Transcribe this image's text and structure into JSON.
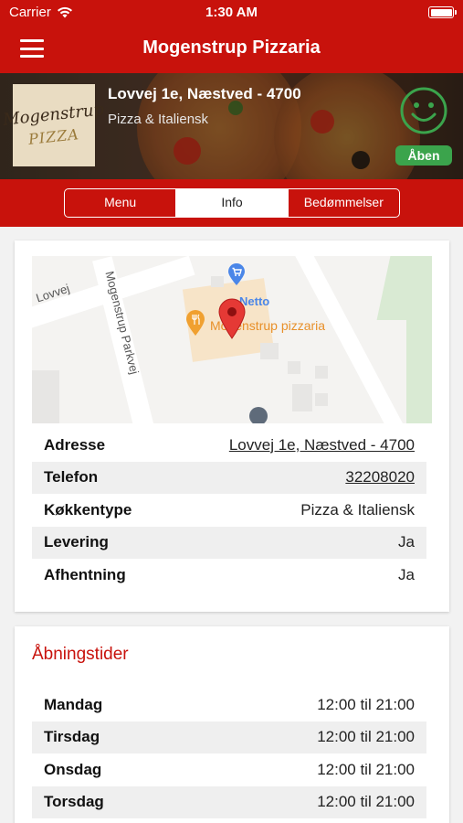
{
  "status_bar": {
    "carrier": "Carrier",
    "time": "1:30 AM"
  },
  "nav": {
    "title": "Mogenstrup Pizzaria"
  },
  "header": {
    "logo_top": "Mogenstrup",
    "logo_bottom": "PIZZA",
    "address": "Lovvej 1e, Næstved - 4700",
    "cuisine": "Pizza & Italiensk",
    "status_badge": "Åben",
    "accent_green": "#3ba44c"
  },
  "tabs": [
    {
      "label": "Menu"
    },
    {
      "label": "Info"
    },
    {
      "label": "Bedømmelser"
    }
  ],
  "map": {
    "street_1": "Lovvej",
    "street_2": "Mogenstrup Parkvej",
    "poi_label": "Mogenstrup pizzaria",
    "poi_label_2": "Netto"
  },
  "info": {
    "rows": [
      {
        "key": "Adresse",
        "value": "Lovvej 1e, Næstved - 4700"
      },
      {
        "key": "Telefon",
        "value": "32208020"
      },
      {
        "key": "Køkkentype",
        "value": "Pizza & Italiensk"
      },
      {
        "key": "Levering",
        "value": "Ja"
      },
      {
        "key": "Afhentning",
        "value": "Ja"
      }
    ]
  },
  "hours": {
    "title": "Åbningstider",
    "rows": [
      {
        "day": "Mandag",
        "time": "12:00 til 21:00"
      },
      {
        "day": "Tirsdag",
        "time": "12:00 til 21:00"
      },
      {
        "day": "Onsdag",
        "time": "12:00 til 21:00"
      },
      {
        "day": "Torsdag",
        "time": "12:00 til 21:00"
      }
    ]
  },
  "colors": {
    "brand_red": "#c8120c",
    "map_pin_red": "#e53935",
    "poi_orange": "#f0a030"
  }
}
